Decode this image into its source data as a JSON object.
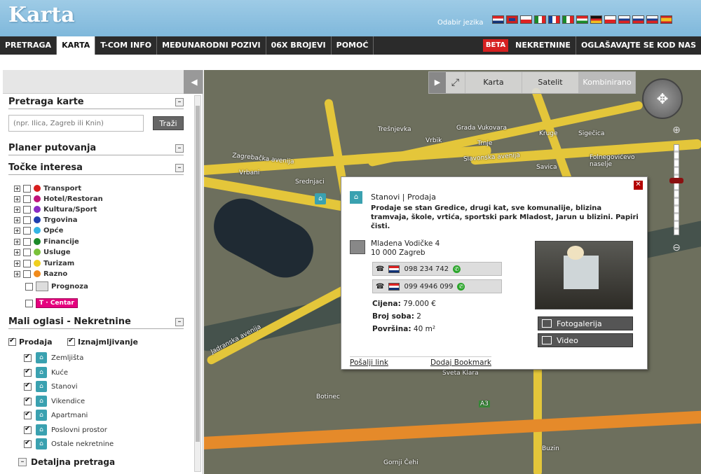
{
  "header": {
    "logo": "Karta",
    "lang_label": "Odabir jezika",
    "flags": [
      "hr-flag-icon",
      "uk-flag-icon",
      "cz-flag-icon",
      "it-flag-icon",
      "fr-flag-icon",
      "it2-flag-icon",
      "hu-flag-icon",
      "de-flag-icon",
      "pl-flag-icon",
      "ru-flag-icon",
      "sk-flag-icon",
      "si-flag-icon",
      "es-flag-icon"
    ]
  },
  "nav": {
    "items": [
      "PRETRAGA",
      "KARTA",
      "T-COM INFO",
      "MEĐUNARODNI POZIVI",
      "06X BROJEVI",
      "POMOĆ"
    ],
    "beta": "BETA",
    "right": [
      "NEKRETNINE",
      "OGLAŠAVAJTE SE KOD NAS"
    ]
  },
  "sidebar": {
    "search_title": "Pretraga karte",
    "search_placeholder": "(npr. Ilica, Zagreb ili Knin)",
    "search_button": "Traži",
    "planner": "Planer putovanja",
    "poi_title": "Točke interesa",
    "poi": [
      {
        "label": "Transport",
        "color": "#d81e1e"
      },
      {
        "label": "Hotel/Restoran",
        "color": "#c0147a"
      },
      {
        "label": "Kultura/Sport",
        "color": "#8a2bc4"
      },
      {
        "label": "Trgovina",
        "color": "#1f3fb0"
      },
      {
        "label": "Opće",
        "color": "#33b5e5"
      },
      {
        "label": "Financije",
        "color": "#1b8a2a"
      },
      {
        "label": "Usluge",
        "color": "#7ac23a"
      },
      {
        "label": "Turizam",
        "color": "#f0d020"
      },
      {
        "label": "Razno",
        "color": "#f08a1a"
      }
    ],
    "prognoza": "Prognoza",
    "tcentar": "T · Centar",
    "ads_title": "Mali oglasi - Nekretnine",
    "prodaja": "Prodaja",
    "iznajmljivanje": "Iznajmljivanje",
    "ads": [
      "Zemljišta",
      "Kuće",
      "Stanovi",
      "Vikendice",
      "Apartmani",
      "Poslovni prostor",
      "Ostale nekretnine"
    ],
    "detailed": "Detaljna pretraga"
  },
  "map": {
    "toolbar": [
      "Karta",
      "Satelit",
      "Kombinirano"
    ],
    "labels": [
      "Trešnjevka",
      "Grada Vukovara",
      "Vrbik",
      "Trnje",
      "Kruge",
      "Sigečica",
      "Zagrebačka avenija",
      "Slavonska avenija",
      "Savica",
      "Folnegovićevo naselje",
      "Vrbani",
      "Srednjaci",
      "Jadranska avenija",
      "Botinec",
      "Sveta Klara",
      "Buzin",
      "Gornji Čehi",
      "A3"
    ]
  },
  "popup": {
    "category": "Stanovi | Prodaja",
    "description": "Prodaje se stan Gredice, drugi kat, sve komunalije, blizina tramvaja, škole, vrtića, sportski park Mladost, Jarun u blizini. Papiri čisti.",
    "address1": "Mladena Vodičke 4",
    "address2": "10 000 Zagreb",
    "phone1": "098 234 742",
    "phone2": "099 4946 099",
    "price_label": "Cijena:",
    "price": "79.000 €",
    "rooms_label": "Broj soba:",
    "rooms": "2",
    "area_label": "Površina:",
    "area": "40 m²",
    "gallery": "Fotogalerija",
    "video": "Video",
    "send_link": "Pošalji link",
    "bookmark": "Dodaj Bookmark"
  }
}
